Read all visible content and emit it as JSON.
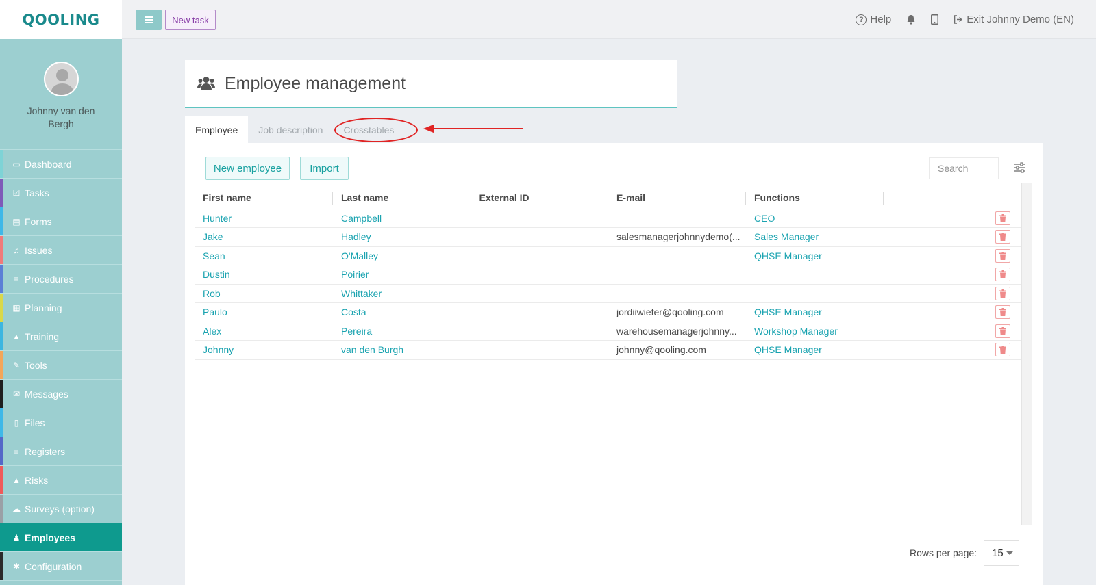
{
  "app": {
    "logo": "QOOLING",
    "user_name": "Johnny van den Bergh"
  },
  "sidebar": {
    "items": [
      {
        "label": "Dashboard",
        "icon": "monitor-icon",
        "color": "#7ed3d6"
      },
      {
        "label": "Tasks",
        "icon": "checkbox-icon",
        "color": "#7e5ab8"
      },
      {
        "label": "Forms",
        "icon": "document-icon",
        "color": "#3fb8e8"
      },
      {
        "label": "Issues",
        "icon": "bell-icon",
        "color": "#f07a7a"
      },
      {
        "label": "Procedures",
        "icon": "list-icon",
        "color": "#5b7fd6"
      },
      {
        "label": "Planning",
        "icon": "calendar-icon",
        "color": "#d9d84a"
      },
      {
        "label": "Training",
        "icon": "graduation-cap-icon",
        "color": "#3db6e0"
      },
      {
        "label": "Tools",
        "icon": "wrench-icon",
        "color": "#f4a65a"
      },
      {
        "label": "Messages",
        "icon": "envelope-icon",
        "color": "#1f1f1f"
      },
      {
        "label": "Files",
        "icon": "file-icon",
        "color": "#3fb8e8"
      },
      {
        "label": "Registers",
        "icon": "list-icon",
        "color": "#5468c8"
      },
      {
        "label": "Risks",
        "icon": "warning-icon",
        "color": "#ef5a5a"
      },
      {
        "label": "Surveys (option)",
        "icon": "chat-icon",
        "color": "#9aa0a6"
      },
      {
        "label": "Employees",
        "icon": "users-icon",
        "color": "#0e9a8e"
      },
      {
        "label": "Configuration",
        "icon": "gear-icon",
        "color": "#2a2a2a"
      }
    ],
    "active_index": 13
  },
  "topbar": {
    "new_task_label": "New task",
    "help_label": "Help",
    "exit_label": "Exit Johnny Demo (EN)"
  },
  "page": {
    "title": "Employee management",
    "tabs": [
      {
        "label": "Employee",
        "active": true
      },
      {
        "label": "Job description",
        "active": false
      },
      {
        "label": "Crosstables",
        "active": false
      }
    ]
  },
  "toolbar": {
    "new_employee_label": "New employee",
    "import_label": "Import",
    "search_placeholder": "Search"
  },
  "table": {
    "columns": [
      "First name",
      "Last name",
      "External ID",
      "E-mail",
      "Functions"
    ],
    "rows": [
      {
        "first": "Hunter",
        "last": "Campbell",
        "external_id": "",
        "email": "",
        "function": "CEO"
      },
      {
        "first": "Jake",
        "last": "Hadley",
        "external_id": "",
        "email": "salesmanagerjohnnydemo(...",
        "function": "Sales Manager"
      },
      {
        "first": "Sean",
        "last": "O'Malley",
        "external_id": "",
        "email": "",
        "function": "QHSE Manager"
      },
      {
        "first": "Dustin",
        "last": "Poirier",
        "external_id": "",
        "email": "",
        "function": ""
      },
      {
        "first": "Rob",
        "last": "Whittaker",
        "external_id": "",
        "email": "",
        "function": ""
      },
      {
        "first": "Paulo",
        "last": "Costa",
        "external_id": "",
        "email": "jordiiwiefer@qooling.com",
        "function": "QHSE Manager"
      },
      {
        "first": "Alex",
        "last": "Pereira",
        "external_id": "",
        "email": "warehousemanagerjohnny...",
        "function": "Workshop Manager"
      },
      {
        "first": "Johnny",
        "last": "van den Burgh",
        "external_id": "",
        "email": "johnny@qooling.com",
        "function": "QHSE Manager"
      }
    ]
  },
  "pagination": {
    "rows_per_page_label": "Rows per page:",
    "rows_per_page_value": "15"
  },
  "colors": {
    "accent": "#1aa3b0",
    "sidebar_bg": "#9ccfd0",
    "active_nav": "#0e9a8e",
    "annotation": "#e02424"
  }
}
